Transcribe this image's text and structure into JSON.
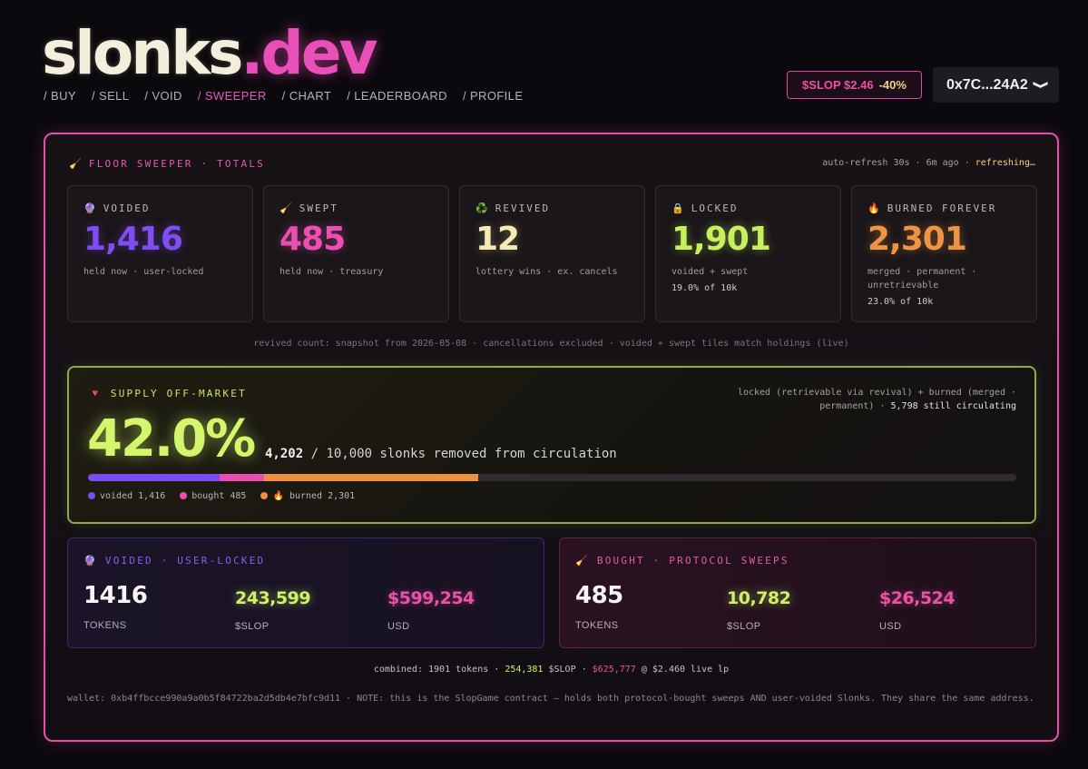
{
  "header": {
    "logo_main": "slonks",
    "logo_accent": ".dev",
    "nav": [
      "/ BUY",
      "/ SELL",
      "/ VOID",
      "/ SWEEPER",
      "/ CHART",
      "/ LEADERBOARD",
      "/ PROFILE"
    ],
    "active_nav": "/ SWEEPER",
    "price_label": "$SLOP $2.46",
    "price_change": "-40%",
    "wallet_short": "0x7C...24A2",
    "wallet_chevron": "❯"
  },
  "panel": {
    "title": "FLOOR SWEEPER · TOTALS",
    "title_icon": "🧹",
    "refresh_prefix": "auto-refresh 30s · 6m ago · ",
    "refresh_status": "refreshing…",
    "cards": [
      {
        "icon": "🔮",
        "label": "VOIDED",
        "value": "1,416",
        "sub": "held now · user-locked",
        "pct": ""
      },
      {
        "icon": "🧹",
        "label": "SWEPT",
        "value": "485",
        "sub": "held now · treasury",
        "pct": ""
      },
      {
        "icon": "♻️",
        "label": "REVIVED",
        "value": "12",
        "sub": "lottery wins · ex. cancels",
        "pct": ""
      },
      {
        "icon": "🔒",
        "label": "LOCKED",
        "value": "1,901",
        "sub": "voided + swept",
        "pct": "19.0% of 10k"
      },
      {
        "icon": "🔥",
        "label": "BURNED FOREVER",
        "value": "2,301",
        "sub": "merged · permanent · unretrievable",
        "pct": "23.0% of 10k"
      }
    ],
    "footnote": "revived count: snapshot from 2026-05-08 · cancellations excluded · voided + swept tiles match holdings (live)"
  },
  "offmarket": {
    "icon": "🔻",
    "title": "SUPPLY OFF-MARKET",
    "desc_prefix": "locked (retrievable via revival) + burned (merged · permanent) · ",
    "desc_highlight": "5,798 still circulating",
    "percent": "42.0%",
    "removed_count": "4,202",
    "removed_rest": " / 10,000 slonks removed from circulation",
    "total": 10000,
    "bar": [
      {
        "name": "voided",
        "value": 1416,
        "color": "#7b4cf0"
      },
      {
        "name": "bought",
        "value": 485,
        "color": "#e84eb0"
      },
      {
        "name": "burned",
        "value": 2301,
        "color": "#ec8f3f"
      }
    ],
    "legend": [
      {
        "label": "voided 1,416",
        "color": "#7b4cf0"
      },
      {
        "label": "bought 485",
        "color": "#e84eb0"
      },
      {
        "label": "🔥 burned 2,301",
        "color": "#ec8f3f"
      }
    ]
  },
  "voided_panel": {
    "icon": "🔮",
    "title": "VOIDED · USER-LOCKED",
    "tokens": "1416",
    "tokens_unit": "TOKENS",
    "slop": "243,599",
    "slop_unit": "$SLOP",
    "usd": "$599,254",
    "usd_unit": "USD"
  },
  "bought_panel": {
    "icon": "🧹",
    "title": "BOUGHT · PROTOCOL SWEEPS",
    "tokens": "485",
    "tokens_unit": "TOKENS",
    "slop": "10,782",
    "slop_unit": "$SLOP",
    "usd": "$26,524",
    "usd_unit": "USD"
  },
  "combined": {
    "prefix": "combined: 1901 tokens · ",
    "slop": "254,381",
    "slop_suffix": " $SLOP · ",
    "usd": "$625,777",
    "suffix": " @ $2.460 live lp"
  },
  "wallet_note": "wallet: 0xb4ffbcce990a9a0b5f84722ba2d5db4e7bfc9d11 · NOTE: this is the SlopGame contract — holds both protocol-bought sweeps AND user-voided Slonks. They share the same address."
}
